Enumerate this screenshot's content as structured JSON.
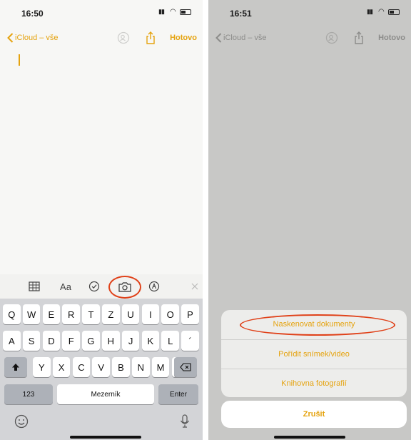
{
  "left": {
    "status": {
      "time": "16:50"
    },
    "nav": {
      "back_label": "iCloud – vše",
      "done_label": "Hotovo"
    },
    "format_bar": {
      "text_style_label": "Aa"
    },
    "keyboard": {
      "row1": [
        "Q",
        "W",
        "E",
        "R",
        "T",
        "Z",
        "U",
        "I",
        "O",
        "P"
      ],
      "row2": [
        "A",
        "S",
        "D",
        "F",
        "G",
        "H",
        "J",
        "K",
        "L",
        "´"
      ],
      "row3": [
        "Y",
        "X",
        "C",
        "V",
        "B",
        "N",
        "M",
        "ˇ"
      ],
      "numbers_label": "123",
      "space_label": "Mezerník",
      "enter_label": "Enter"
    }
  },
  "right": {
    "status": {
      "time": "16:51"
    },
    "nav": {
      "back_label": "iCloud – vše",
      "done_label": "Hotovo"
    },
    "sheet": {
      "items": [
        "Naskenovat dokumenty",
        "Pořídit snímek/video",
        "Knihovna fotografií"
      ],
      "cancel_label": "Zrušit"
    }
  },
  "colors": {
    "accent": "#e5a30f",
    "annotation": "#e0421a"
  }
}
